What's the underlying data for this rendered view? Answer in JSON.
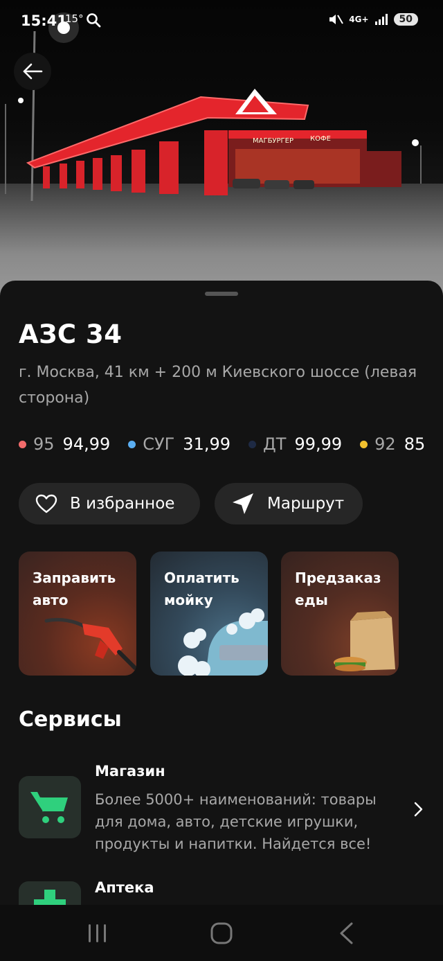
{
  "status_bar": {
    "time": "15:41",
    "temperature": "15°",
    "network": "4G+",
    "battery": "50"
  },
  "station": {
    "name": "АЗС 34",
    "address": "г. Москва, 41 км + 200 м Киевского шоссе (левая сторона)"
  },
  "prices": [
    {
      "type": "95",
      "value": "94,99",
      "color": "#f26b6b"
    },
    {
      "type": "СУГ",
      "value": "31,99",
      "color": "#5aaef2"
    },
    {
      "type": "ДТ",
      "value": "99,99",
      "color": "#1e2a44"
    },
    {
      "type": "92",
      "value": "85",
      "color": "#f2c12e"
    }
  ],
  "actions": {
    "favorite_label": "В избранное",
    "route_label": "Маршрут"
  },
  "cards": [
    {
      "label": "Заправить авто"
    },
    {
      "label": "Оплатить мойку"
    },
    {
      "label": "Предзаказ еды"
    }
  ],
  "services": {
    "title": "Сервисы",
    "items": [
      {
        "title": "Магазин",
        "description": "Более 5000+ наименований: товары для дома, авто, детские игрушки, продукты и напитки. Найдется все!"
      },
      {
        "title": "Аптека"
      }
    ]
  },
  "colors": {
    "accent_green": "#2fd07d",
    "station_red": "#e4252c"
  }
}
